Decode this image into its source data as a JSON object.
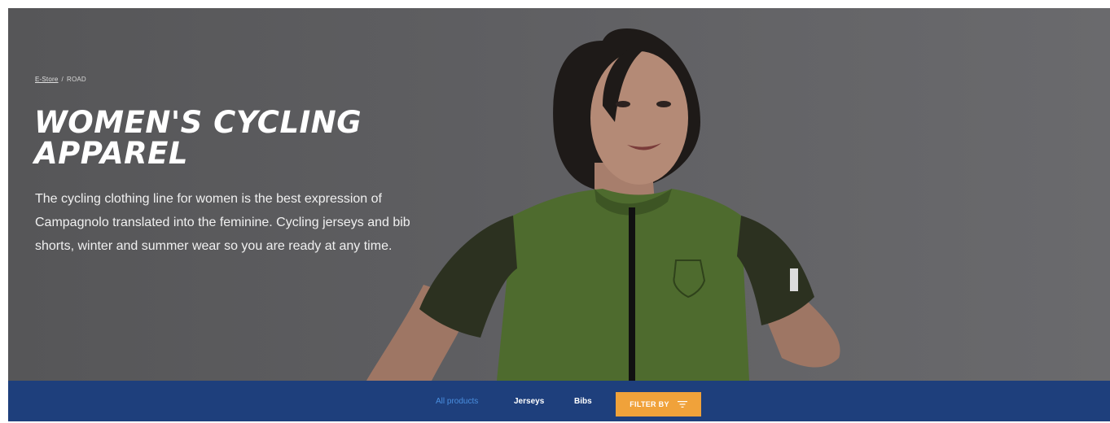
{
  "breadcrumb": {
    "home": "E-Store",
    "separator": "/",
    "current": "ROAD"
  },
  "hero": {
    "title": "WOMEN'S CYCLING APPAREL",
    "description": "The cycling clothing line for women is the best expression of Campagnolo translated into the feminine. Cycling jerseys and bib shorts, winter and summer wear so you are ready at any time."
  },
  "nav": {
    "tabs": [
      {
        "label": "All products",
        "active": true
      },
      {
        "label": "Jerseys",
        "active": false
      },
      {
        "label": "Bibs",
        "active": false
      }
    ],
    "filter_label": "FILTER BY",
    "filter_icon": "filter-icon"
  },
  "colors": {
    "nav_bg": "#1e3f7c",
    "active_tab": "#4a8fe0",
    "filter_button": "#f0a23a",
    "jersey": "#4e6b2e"
  }
}
